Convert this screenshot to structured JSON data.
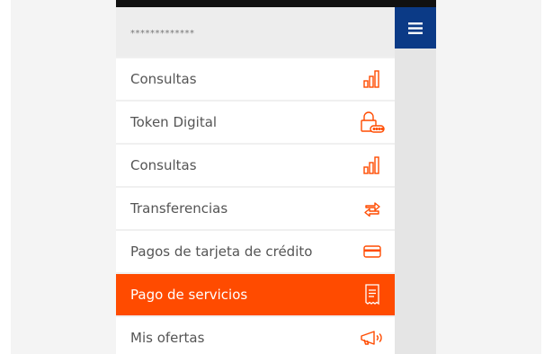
{
  "header": {
    "masked_user": "*************",
    "menu_icon": "hamburger-icon"
  },
  "menu": {
    "items": [
      {
        "label": "Consultas",
        "icon": "bar-chart-icon",
        "active": false
      },
      {
        "label": "Token Digital",
        "icon": "padlock-token-icon",
        "active": false
      },
      {
        "label": "Consultas",
        "icon": "bar-chart-icon",
        "active": false
      },
      {
        "label": "Transferencias",
        "icon": "transfer-arrows-icon",
        "active": false
      },
      {
        "label": "Pagos de tarjeta de crédito",
        "icon": "credit-card-icon",
        "active": false
      },
      {
        "label": "Pago de servicios",
        "icon": "receipt-icon",
        "active": true
      },
      {
        "label": "Mis ofertas",
        "icon": "megaphone-icon",
        "active": false
      }
    ]
  },
  "colors": {
    "accent": "#ff4b00",
    "nav_blue": "#0b3a86",
    "text": "#555555"
  }
}
